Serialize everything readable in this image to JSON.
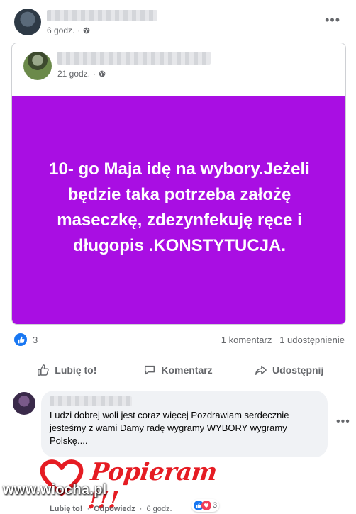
{
  "post": {
    "time": "6 godz.",
    "privacy_icon": "globe-icon",
    "menu_icon": "more-icon"
  },
  "shared_post": {
    "time": "21 godz.",
    "privacy_icon": "globe-icon",
    "text": "10- go Maja idę na wybory.Jeżeli będzie taka potrzeba założę maseczkę, zdezynfekuję ręce i długopis .KONSTYTUCJA.",
    "background_color": "#a90ee3"
  },
  "reactions": {
    "count": "3",
    "comments": "1 komentarz",
    "shares": "1 udostępnienie"
  },
  "actions": {
    "like": "Lubię to!",
    "comment": "Komentarz",
    "share": "Udostępnij"
  },
  "comment": {
    "text": "Ludzi dobrej woli jest coraz więcej Pozdrawiam serdecznie jesteśmy z wami Damy radę wygramy WYBORY wygramy Polskę....",
    "sticker_text": "Popieram !!!",
    "like": "Lubię to!",
    "reply": "Odpowiedz",
    "time": "6 godz.",
    "reaction_count": "3"
  },
  "watermark": "www.wiocha.pl",
  "colors": {
    "accent": "#1877f2",
    "sticker_red": "#e51c23"
  }
}
